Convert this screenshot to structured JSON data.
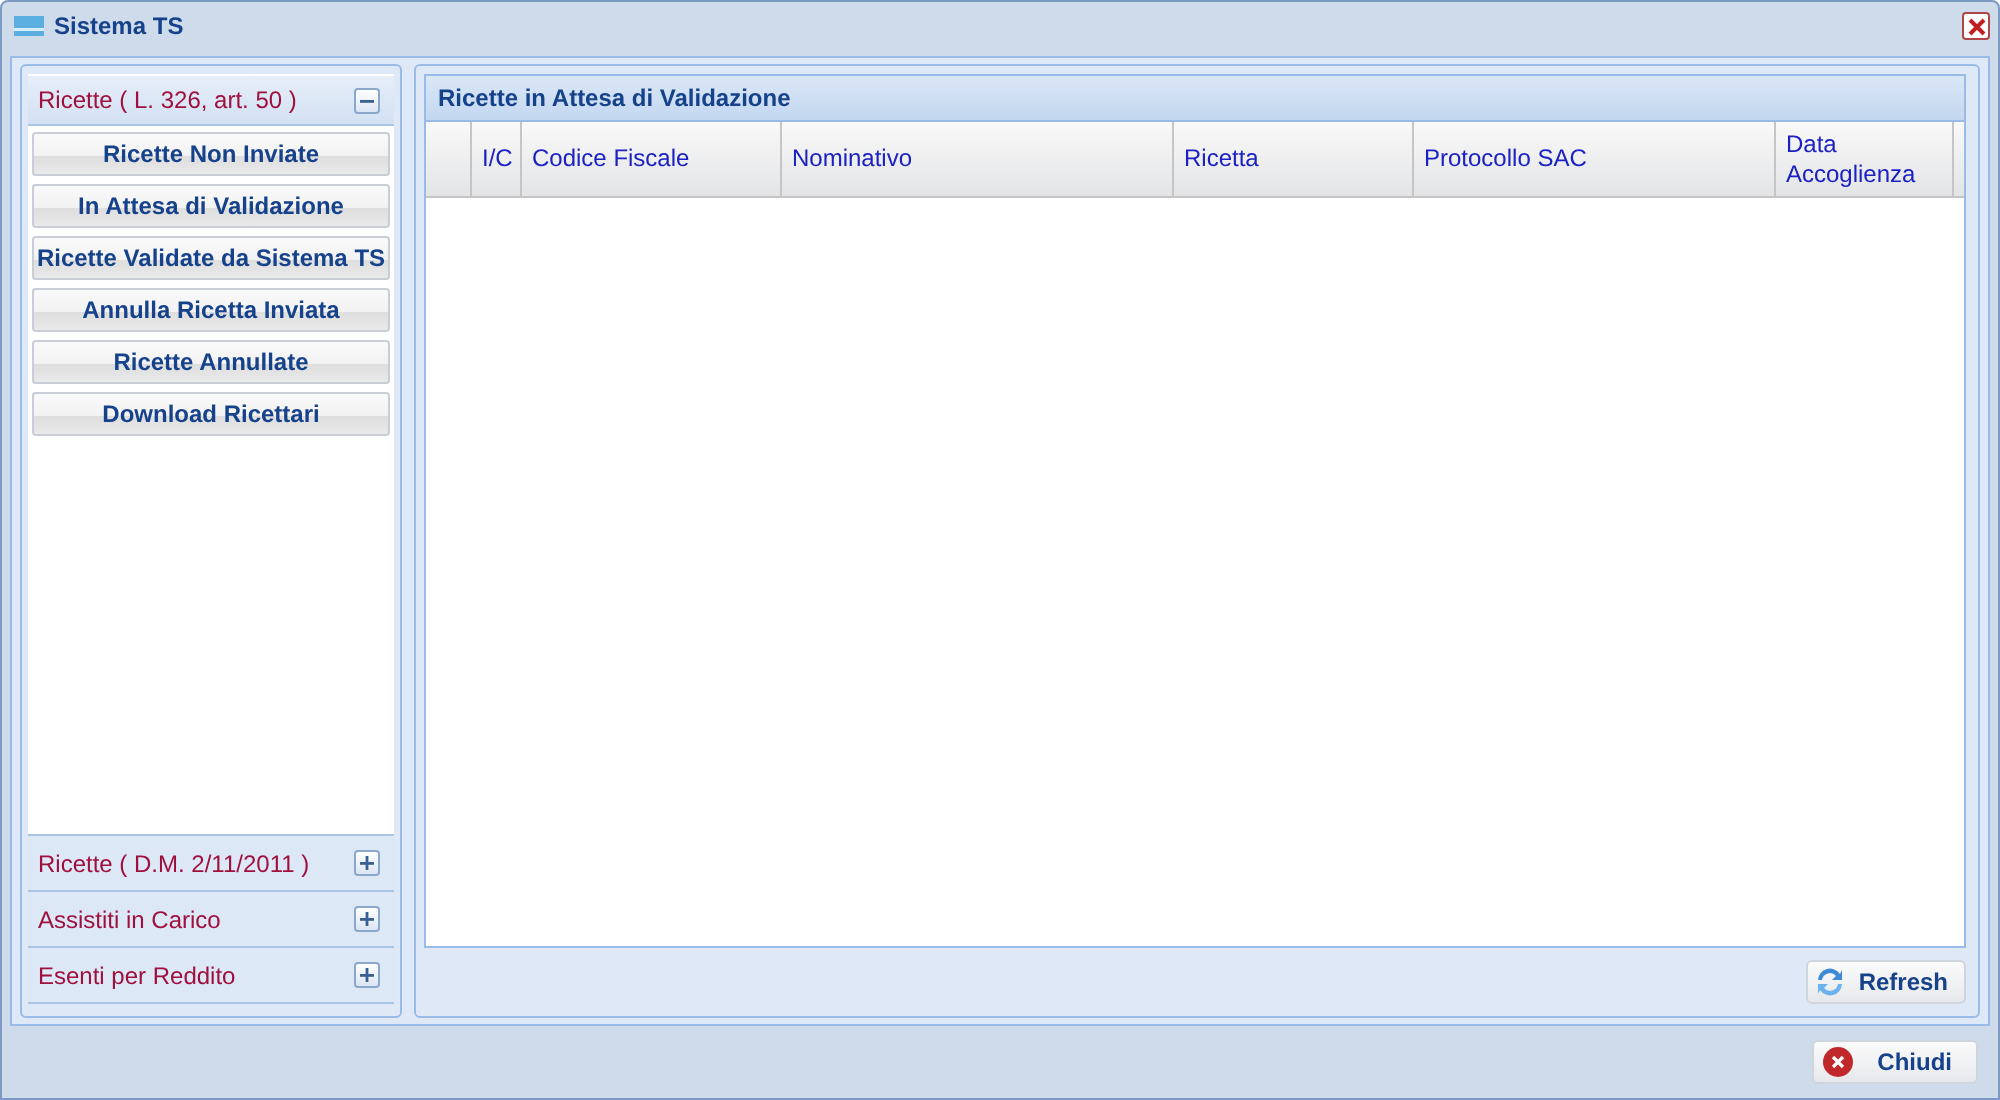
{
  "window": {
    "title": "Sistema TS"
  },
  "sidebar": {
    "sections": [
      {
        "title": "Ricette ( L. 326, art. 50 )",
        "expanded": true,
        "buttons": [
          "Ricette Non Inviate",
          "In Attesa di Validazione",
          "Ricette Validate da Sistema TS",
          "Annulla Ricetta Inviata",
          "Ricette Annullate",
          "Download Ricettari"
        ]
      },
      {
        "title": "Ricette ( D.M. 2/11/2011 )",
        "expanded": false
      },
      {
        "title": "Assistiti in Carico",
        "expanded": false
      },
      {
        "title": "Esenti per Reddito",
        "expanded": false
      }
    ]
  },
  "grid": {
    "title": "Ricette in Attesa di Validazione",
    "columns": [
      "I/C",
      "Codice Fiscale",
      "Nominativo",
      "Ricetta",
      "Protocollo SAC",
      "Data Accoglienza"
    ]
  },
  "buttons": {
    "refresh": "Refresh",
    "close": "Chiudi"
  }
}
